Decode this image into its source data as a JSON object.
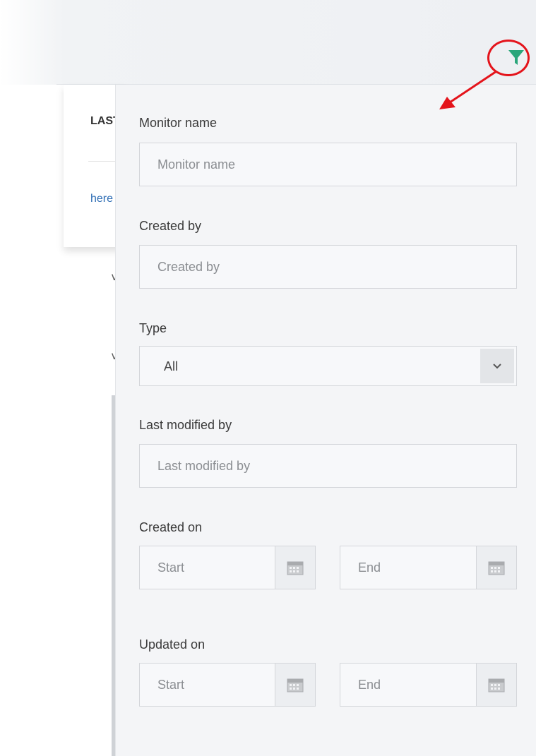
{
  "background": {
    "column_header": "LAST",
    "link_text": "here",
    "row_text_1": "v",
    "row_text_2": "v"
  },
  "toolbar": {
    "filter_icon": "filter-icon",
    "accent_color": "#2aa67a",
    "highlight_color": "#e4141b"
  },
  "filter_panel": {
    "monitor_name": {
      "label": "Monitor name",
      "placeholder": "Monitor name",
      "value": ""
    },
    "created_by": {
      "label": "Created by",
      "placeholder": "Created by",
      "value": ""
    },
    "type": {
      "label": "Type",
      "selected": "All",
      "icon": "chevron-down-icon"
    },
    "last_modified_by": {
      "label": "Last modified by",
      "placeholder": "Last modified by",
      "value": ""
    },
    "created_on": {
      "label": "Created on",
      "start_placeholder": "Start",
      "end_placeholder": "End",
      "icon": "calendar-icon"
    },
    "updated_on": {
      "label": "Updated on",
      "start_placeholder": "Start",
      "end_placeholder": "End",
      "icon": "calendar-icon"
    }
  }
}
